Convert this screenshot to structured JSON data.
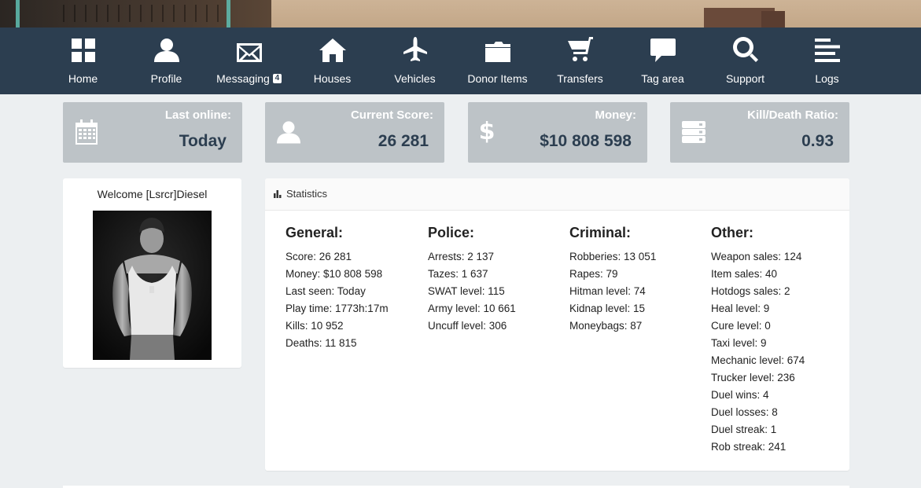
{
  "nav": {
    "items": [
      {
        "label": "Home",
        "icon": "home-grid-icon"
      },
      {
        "label": "Profile",
        "icon": "user-icon"
      },
      {
        "label": "Messaging",
        "icon": "envelope-icon",
        "badge": "4"
      },
      {
        "label": "Houses",
        "icon": "house-icon"
      },
      {
        "label": "Vehicles",
        "icon": "plane-icon"
      },
      {
        "label": "Donor Items",
        "icon": "folder-icon"
      },
      {
        "label": "Transfers",
        "icon": "cart-icon"
      },
      {
        "label": "Tag area",
        "icon": "comment-icon"
      },
      {
        "label": "Support",
        "icon": "search-icon"
      },
      {
        "label": "Logs",
        "icon": "align-left-icon"
      }
    ]
  },
  "cards": [
    {
      "title": "Last online:",
      "value": "Today",
      "icon": "calendar-icon"
    },
    {
      "title": "Current Score:",
      "value": "26 281",
      "icon": "user-icon"
    },
    {
      "title": "Money:",
      "value": "$10 808 598",
      "icon": "dollar-icon"
    },
    {
      "title": "Kill/Death Ratio:",
      "value": "0.93",
      "icon": "server-icon"
    }
  ],
  "profile": {
    "welcome": "Welcome [Lsrcr]Diesel"
  },
  "statistics": {
    "title": "Statistics",
    "columns": [
      {
        "title": "General:",
        "lines": [
          "Score: 26 281",
          "Money: $10 808 598",
          "Last seen: Today",
          "Play time: 1773h:17m",
          "Kills: 10 952",
          "Deaths: 11 815"
        ]
      },
      {
        "title": "Police:",
        "lines": [
          "Arrests: 2 137",
          "Tazes: 1 637",
          "SWAT level: 115",
          "Army level: 10 661",
          "Uncuff level: 306"
        ]
      },
      {
        "title": "Criminal:",
        "lines": [
          "Robberies: 13 051",
          "Rapes: 79",
          "Hitman level: 74",
          "Kidnap level: 15",
          "Moneybags: 87"
        ]
      },
      {
        "title": "Other:",
        "lines": [
          "Weapon sales: 124",
          "Item sales: 40",
          "Hotdogs sales: 2",
          "Heal level: 9",
          "Cure level: 0",
          "Taxi level: 9",
          "Mechanic level: 674",
          "Trucker level: 236",
          "Duel wins: 4",
          "Duel losses: 8",
          "Duel streak: 1",
          "Rob streak: 241"
        ]
      }
    ]
  },
  "colors": {
    "navbar": "#2c3e50",
    "card": "#bdc3c7",
    "card_value": "#2c3e50",
    "page_bg": "#eceff1"
  }
}
